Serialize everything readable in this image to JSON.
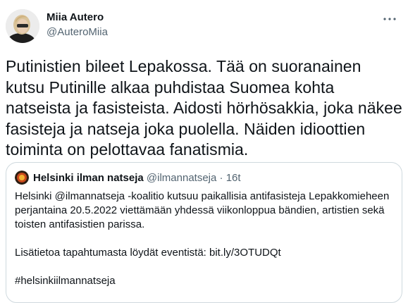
{
  "tweet": {
    "author_name": "Miia Autero",
    "author_handle": "@AuteroMiia",
    "more_icon": "more-dots-icon",
    "text": "Putinistien bileet Lepakossa. Tää on suoranainen kutsu Putinille alkaa puhdistaa Suomea kohta natseista ja fasisteista. Aidosti hörhösakkia, joka näkee fasisteja ja natseja joka puolella. Näiden idioottien toiminta on pelottavaa fanatismia."
  },
  "quote": {
    "name": "Helsinki ilman natseja",
    "handle": "@ilmannatseja",
    "separator": "·",
    "time": "16t",
    "paragraph1": "Helsinki @ilmannatseja -koalitio kutsuu paikallisia antifasisteja Lepakkomieheen perjantaina 20.5.2022 viettämään yhdessä viikonloppua bändien, artistien sekä toisten antifasistien parissa.",
    "paragraph2": "Lisätietoa tapahtumasta löydät eventistä: bit.ly/3OTUDQt",
    "paragraph3": "#helsinkiilmannatseja"
  }
}
